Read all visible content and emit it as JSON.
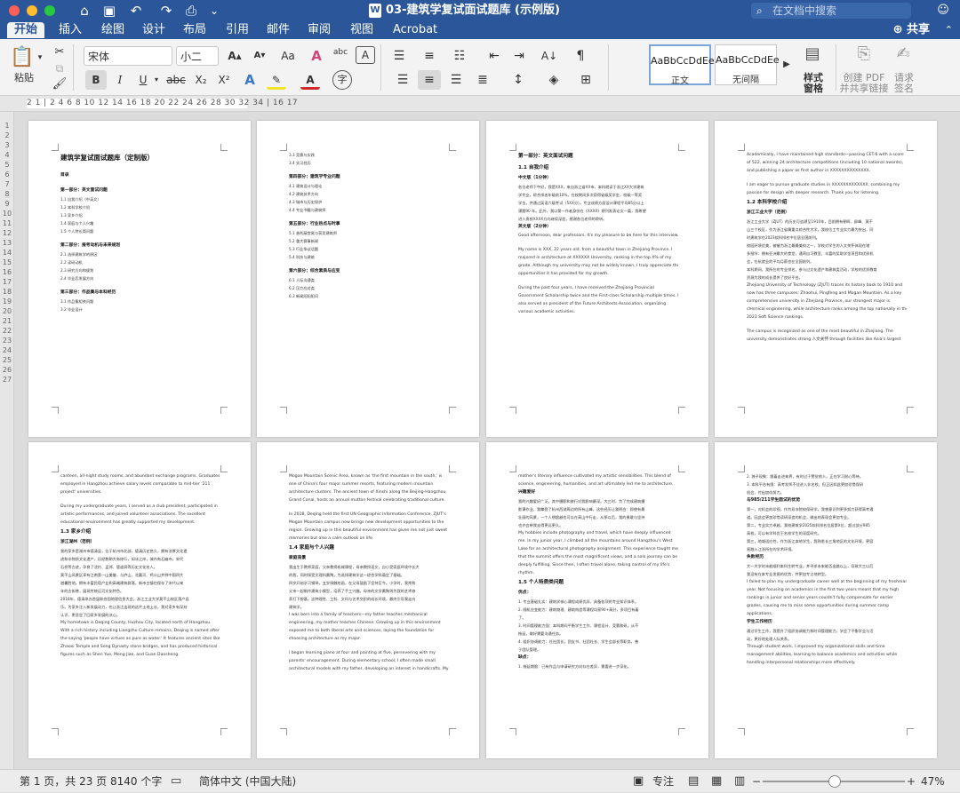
{
  "window": {
    "title": "03-建筑学复试面试题库 (示例版)",
    "doc_icon": "W",
    "search_placeholder": "在文档中搜索",
    "traffic_colors": {
      "close": "#fe5f57",
      "minimize": "#febc2e",
      "maximize": "#28c840"
    }
  },
  "quick_access": {
    "home": "⌂",
    "save": "▣",
    "undo": "↶",
    "redo": "↷",
    "print": "⎙",
    "more": "⌄"
  },
  "tabs": [
    {
      "label": "开始",
      "active": true
    },
    {
      "label": "插入"
    },
    {
      "label": "绘图"
    },
    {
      "label": "设计"
    },
    {
      "label": "布局"
    },
    {
      "label": "引用"
    },
    {
      "label": "邮件"
    },
    {
      "label": "审阅"
    },
    {
      "label": "视图"
    },
    {
      "label": "Acrobat"
    }
  ],
  "share_label": "共享",
  "ribbon": {
    "paste_label": "粘贴",
    "font_name": "宋体",
    "font_size": "小二",
    "bold": "B",
    "italic": "I",
    "underline": "U",
    "strikethrough": "abc",
    "subscript": "X₂",
    "superscript": "X²",
    "grow_font": "A▴",
    "shrink_font": "A▾",
    "change_case": "Aa",
    "clear_format": "A",
    "phonetic": "abc",
    "char_border": "A",
    "text_effects": "A",
    "highlight": "✎",
    "font_color": "A",
    "enclose": "字",
    "styles": [
      {
        "sample": "AaBbCcDdEe",
        "name": "正文",
        "active": true
      },
      {
        "sample": "AaBbCcDdEe",
        "name": "无间隔"
      }
    ],
    "styles_pane_label": "样式\n窗格",
    "create_pdf_label": "创建 PDF\n并共享链接",
    "request_sign_label": "请求\n签名"
  },
  "ruler_text": "2 1 | 2 4 6 8 10 12 14 16 18 20 22 24 26 28 30 32 34 | 16 17",
  "vruler_text": "1 2 3 4 5 6 7 8 9 10 11 12 13 14 15 16 17 18 19 20 21 22 23 24 25 26 27",
  "pages": [
    {
      "lines": [
        {
          "t": "建筑学复试面试题库（定制版）",
          "c": "title"
        },
        {
          "t": "",
          "c": "gap"
        },
        {
          "t": "目录",
          "c": "h3"
        },
        {
          "t": "",
          "c": "gap"
        },
        {
          "t": "第一部分：英文面试问题",
          "c": "h3"
        },
        {
          "t": "1.1  自我介绍（中英文）",
          "c": "cn"
        },
        {
          "t": "1.2  本科学校介绍",
          "c": "cn"
        },
        {
          "t": "1.3  家乡介绍",
          "c": "cn"
        },
        {
          "t": "1.4  家庭与个人兴趣",
          "c": "cn"
        },
        {
          "t": "1.5  个人特长简问题",
          "c": "cn"
        },
        {
          "t": "",
          "c": "gap"
        },
        {
          "t": "第二部分：报考动机与未来规划",
          "c": "h3"
        },
        {
          "t": "2.1  选择建筑学的原因",
          "c": "cn"
        },
        {
          "t": "2.2  读研动机",
          "c": "cn"
        },
        {
          "t": "2.3  研究方向和规划",
          "c": "cn"
        },
        {
          "t": "2.4  毕业后发展方向",
          "c": "cn"
        },
        {
          "t": "",
          "c": "gap"
        },
        {
          "t": "第三部分：作品集与本科经历",
          "c": "h3"
        },
        {
          "t": "3.1  作品集相关问题",
          "c": "cn"
        },
        {
          "t": "3.2  毕业设计",
          "c": "cn"
        }
      ]
    },
    {
      "lines": [
        {
          "t": "3.3  竞赛与实践",
          "c": "cn"
        },
        {
          "t": "3.4  实习经历",
          "c": "cn"
        },
        {
          "t": "",
          "c": "gap"
        },
        {
          "t": "第四部分：建筑学专业问题",
          "c": "h3"
        },
        {
          "t": "4.1  建筑设计与理论",
          "c": "cn"
        },
        {
          "t": "4.2  建筑技术方向",
          "c": "cn"
        },
        {
          "t": "4.3  城市与历史保护",
          "c": "cn"
        },
        {
          "t": "4.4  专业书籍与建筑师",
          "c": "cn"
        },
        {
          "t": "",
          "c": "gap"
        },
        {
          "t": "第五部分：行业热点与时事",
          "c": "h3"
        },
        {
          "t": "5.1  香利蔽宫尾与获奖建筑师",
          "c": "cn"
        },
        {
          "t": "5.2  重大赛事新闻",
          "c": "cn"
        },
        {
          "t": "5.3  行业争议话题",
          "c": "cn"
        },
        {
          "t": "5.4  科技与建筑",
          "c": "cn"
        },
        {
          "t": "",
          "c": "gap"
        },
        {
          "t": "第六部分：综合素质与应变",
          "c": "h3"
        },
        {
          "t": "6.1  人际沟通类",
          "c": "cn"
        },
        {
          "t": "6.2  压力应对类",
          "c": "cn"
        },
        {
          "t": "6.3  新闻阳阳阳问",
          "c": "cn"
        }
      ]
    },
    {
      "lines": [
        {
          "t": "第一部分：英文面试问题",
          "c": "h2"
        },
        {
          "t": "1.1  自我介绍",
          "c": "h2"
        },
        {
          "t": "中文版（1分钟）",
          "c": "h3"
        },
        {
          "t": "各位老师下午好，我是XXX，来自浙江省XX市。本科就读于浙江XX大学建筑",
          "c": "cn"
        },
        {
          "t": "学专业，综合排名年级前10%。在校期间多次获得省级奖学金，校级一等奖",
          "c": "cn"
        },
        {
          "t": "学金，并通过英语六级考试（5XX分）。专业成绩方面设计课程平均85分以上",
          "c": "cn"
        },
        {
          "t": "课题90 年。此外，我以第一作者身份在《XXXX》期刊发表论文一篇，我希望",
          "c": "cn"
        },
        {
          "t": "进入贵校XXXX方向继续深造，感谢各位老师的聆听。",
          "c": "cn"
        },
        {
          "t": "英文版（2分钟）",
          "c": "h3"
        },
        {
          "t": "Good afternoon, dear professors. It's my pleasure to be here for this interview.",
          "c": ""
        },
        {
          "t": "",
          "c": "gap"
        },
        {
          "t": "My name is XXX, 22 years old, from a beautiful town in Zhejiang Province. I",
          "c": ""
        },
        {
          "t": "majored in architecture at XXXXXX University, ranking in the top X% of my",
          "c": ""
        },
        {
          "t": "grade. Although my university may not be widely known, I truly appreciate the",
          "c": ""
        },
        {
          "t": "opportunities it has provided for my growth.",
          "c": ""
        },
        {
          "t": "",
          "c": "gap"
        },
        {
          "t": "During the past four years, I have received the Zhejiang Provincial",
          "c": ""
        },
        {
          "t": "Government Scholarship twice and the First-class Scholarship multiple times. I",
          "c": ""
        },
        {
          "t": "also served as president of the Future Architects Association, organizing",
          "c": ""
        },
        {
          "t": "various academic activities.",
          "c": ""
        }
      ]
    },
    {
      "lines": [
        {
          "t": "Academically, I have maintained high standards—passing CET-6 with a score",
          "c": ""
        },
        {
          "t": "of 522, winning 24 architecture competitions (including 10 national awards),",
          "c": ""
        },
        {
          "t": "and publishing a paper as first author in XXXXXXXXXXXXXX.",
          "c": ""
        },
        {
          "t": "",
          "c": "gap"
        },
        {
          "t": "I am eager to pursue graduate studies in XXXXXXXXXXXXX, combining my",
          "c": ""
        },
        {
          "t": "passion for design with deeper research. Thank you for listening.",
          "c": ""
        },
        {
          "t": "1.2  本科学校介绍",
          "c": "h2"
        },
        {
          "t": "浙江工业大学（范例）",
          "c": "h3"
        },
        {
          "t": "浙江工业大学（ZJUT）的历史可追溯至1910年，目前拥有朝晖、屏峰、莫干",
          "c": "cn"
        },
        {
          "t": "山三个校区，作为浙江省属重点综合性大学，我校位工专业实力最为突出，同",
          "c": "cn"
        },
        {
          "t": "时建筑学在2023软科排名中位居全国前列。",
          "c": "cn"
        },
        {
          "t": "校园环境优美，被誉为浙江最最美校之一，学校对学生的人文关怀体现在诸",
          "c": "cn"
        },
        {
          "t": "多细节：拥有亚洲最大的食堂，通宵自习教室，丰富的奖助学金项目和优质机",
          "c": "cn"
        },
        {
          "t": "会，在杭就业的平均月薪也在全国前列。",
          "c": "cn"
        },
        {
          "t": "本科期间，我所在的专业排名，参与过文化遗产和建筑类活动，学校的优质教育",
          "c": "cn"
        },
        {
          "t": "资源为我的成长提供了良好平台。",
          "c": "cn"
        },
        {
          "t": "Zhejiang University of Technology (ZJUT) traces its history back to 1910 and",
          "c": ""
        },
        {
          "t": "now has three campuses: Zhaohui, Pingfeng and Mogan Mountain. As a key",
          "c": ""
        },
        {
          "t": "comprehensive university in Zhejiang Province, our strongest major is",
          "c": ""
        },
        {
          "t": "chemical engineering, while architecture ranks among the top nationally in the",
          "c": ""
        },
        {
          "t": "2023 Soft Science rankings.",
          "c": ""
        },
        {
          "t": "",
          "c": "gap"
        },
        {
          "t": "The campus is recognized as one of the most beautiful in Zhejiang. The",
          "c": ""
        },
        {
          "t": "university demonstrates strong 人文关怀 through facilities like Asia's largest",
          "c": ""
        }
      ]
    },
    {
      "lines": [
        {
          "t": "canteen, all-night study rooms, and abundant exchange programs. Graduates",
          "c": ""
        },
        {
          "t": "employed in Hangzhou achieve salary levels comparable to mid-tier '211",
          "c": ""
        },
        {
          "t": "project' universities.",
          "c": ""
        },
        {
          "t": "",
          "c": "gap"
        },
        {
          "t": "During my undergraduate years, I served as a club president, participated in",
          "c": ""
        },
        {
          "t": "artistic performances, and joined volunteer associations. The excellent",
          "c": ""
        },
        {
          "t": "educational environment has greatly supported my development.",
          "c": ""
        },
        {
          "t": "1.3  家乡介绍",
          "c": "h2"
        },
        {
          "t": "浙江湖州（范例）",
          "c": "h3"
        },
        {
          "t": "我的家乡是湖州市德清县，位于杭州市北部，德清历史悠久，拥有浓厚文化遗",
          "c": "cn"
        },
        {
          "t": "迹和非物质文化遗产，历经数朝大有修行，如冰之岸，城内有石幽寺，宋代",
          "c": "cn"
        },
        {
          "t": "石桥等古迹，孕育了沈约、孟郊、管道昇等历史文化名人。",
          "c": "cn"
        },
        {
          "t": "莫干山风景区享有江南第一山美誉，与庐山、北戴河、鸡公山并称中国四大",
          "c": "cn"
        },
        {
          "t": "避暑胜地。拥有丰富民宿产业和高端建筑群落，新市古镇也保存了宋代以来",
          "c": "cn"
        },
        {
          "t": "年的古街巷，展现传统运河文化特色。",
          "c": "cn"
        },
        {
          "t": "2018年，德清承办首届联合国地理信息大会，浙江工业大学莫干山校区落户县",
          "c": "cn"
        },
        {
          "t": "乐。为家乡注入新发展动力，也让浙江出现的这片土地上长，我对家乡有深刻",
          "c": "cn"
        },
        {
          "t": "认识，更坚定了回家乡发展的决心。",
          "c": "cn"
        },
        {
          "t": "My hometown is Deqing County, Huzhou City, located north of Hangzhou.",
          "c": ""
        },
        {
          "t": "With a rich history including Liangzhu Culture remains, Deqing is named after",
          "c": ""
        },
        {
          "t": "the saying 'people have virtues as pure as water.' It features ancient sites like",
          "c": ""
        },
        {
          "t": "Zhaoxi Temple and Song Dynasty stone bridges, and has produced historical",
          "c": ""
        },
        {
          "t": "figures such as Shen Yue, Meng Jiao, and Guan Daosheng.",
          "c": ""
        }
      ]
    },
    {
      "lines": [
        {
          "t": "Mogan Mountain Scenic Area, known as 'the first mountain in the south,' is",
          "c": ""
        },
        {
          "t": "one of China's four major summer resorts, featuring modern mountain",
          "c": ""
        },
        {
          "t": "architecture clusters. The ancient town of Xinshi along the Beijing-Hangzhou",
          "c": ""
        },
        {
          "t": "Grand Canal, hosts an annual mutton festival celebrating traditional culture.",
          "c": ""
        },
        {
          "t": "",
          "c": "gap"
        },
        {
          "t": "In 2018, Deqing held the first UN Geographic Information Conference. ZJUT's",
          "c": ""
        },
        {
          "t": "Mogan Mountain campus now brings new development opportunities to the",
          "c": ""
        },
        {
          "t": "region. Growing up in this beautiful environment has given me not just sweet",
          "c": ""
        },
        {
          "t": "memories but also a calm outlook on life.",
          "c": ""
        },
        {
          "t": "1.4  家庭与个人兴趣",
          "c": "h2"
        },
        {
          "t": "家庭背景",
          "c": "h3"
        },
        {
          "t": "我出生于教师家庭，父亲教授机械课程，母亲教授语文，自小受家庭环境中长大",
          "c": "cn"
        },
        {
          "t": "的我，同时接受文理科熏陶，为选择建筑学这一综合学科奠定了基础。",
          "c": "cn"
        },
        {
          "t": "四岁开始学习钢琴，五岁接触绘画，在父母鼓励下坚持至今。小学时，我常和",
          "c": "cn"
        },
        {
          "t": "父亲一起制作建筑小模型，培养了手工兴趣。母亲的文学熏陶则为我的艺术修",
          "c": "cn"
        },
        {
          "t": "养打下根基。这种理性、工科、文科与艺术交织的成长环境，最终引导我走向",
          "c": "cn"
        },
        {
          "t": "建筑学。",
          "c": "cn"
        },
        {
          "t": "I was born into a family of teachers—my father teaches mechanical",
          "c": ""
        },
        {
          "t": "engineering, my mother teaches Chinese. Growing up in this environment",
          "c": ""
        },
        {
          "t": "exposed me to both liberal arts and sciences, laying the foundation for",
          "c": ""
        },
        {
          "t": "choosing architecture as my major.",
          "c": ""
        },
        {
          "t": "",
          "c": "gap"
        },
        {
          "t": "I began learning piano at four and painting at five, persevering with my",
          "c": ""
        },
        {
          "t": "parents' encouragement. During elementary school, I often made small",
          "c": ""
        },
        {
          "t": "architectural models with my father, developing an interest in handicrafts. My",
          "c": ""
        }
      ]
    },
    {
      "lines": [
        {
          "t": "mother's literary influence cultivated my artistic sensibilities. This blend of",
          "c": ""
        },
        {
          "t": "science, engineering, humanities, and art ultimately led me to architecture.",
          "c": ""
        },
        {
          "t": "兴趣爱好",
          "c": "h3"
        },
        {
          "t": "我的兴趣爱好广泛，其中摄影和旅行对我影响最深。大三时，为了完成建筑摄",
          "c": "cn"
        },
        {
          "t": "影课作业，我攀登了杭州西湖周边的所有山峰，这些经历让我明白：即使有最",
          "c": "cn"
        },
        {
          "t": "壮丽的风景，一个人想超越也可以在高山中行走，从那以后，我的勇敢与坚持",
          "c": "cn"
        },
        {
          "t": "也许会带我走得更远更久。",
          "c": "cn"
        },
        {
          "t": "My hobbies include photography and travel, which have deeply influenced",
          "c": ""
        },
        {
          "t": "me. In my junior year, I climbed all the mountains around Hangzhou's West",
          "c": ""
        },
        {
          "t": "Lake for an architectural photography assignment. This experience taught me",
          "c": ""
        },
        {
          "t": "that the summit offers the most magnificent views, and a solo journey can be",
          "c": ""
        },
        {
          "t": "deeply fulfilling. Since then, I often travel alone, taking control of my life's",
          "c": ""
        },
        {
          "t": "rhythm.",
          "c": ""
        },
        {
          "t": "1.5  个人特质类问题",
          "c": "h2"
        },
        {
          "t": "优点：",
          "c": "h3"
        },
        {
          "t": "1.  专业基础扎实：建筑学核心课程成绩优异，具备各项的专业知识体系。",
          "c": "cn"
        },
        {
          "t": "2.  随机应变能力：建筑物理、建筑构造等课程均获90+高分，多项目有着",
          "c": "cn"
        },
        {
          "t": "     了。",
          "c": "cn"
        },
        {
          "t": "3.  时间管理能力强：本科期间平衡学生工作、课程设计、竞赛和研，从不",
          "c": "cn"
        },
        {
          "t": "     拖延，做好需要沟通任务。",
          "c": "cn"
        },
        {
          "t": "4.  组织协调能力：任社团长，团支书、社团社长、学生会部长等职务，善",
          "c": "cn"
        },
        {
          "t": "     于团队管理。",
          "c": "cn"
        },
        {
          "t": "缺点：",
          "c": "h3"
        },
        {
          "t": "1.  拖延期限：已有作品与申请研究方向存在差异，需要进一步深化。",
          "c": "cn"
        }
      ]
    },
    {
      "lines": [
        {
          "t": "2.  独子现象：跟着走进来界，有时过于警觉他人，正在学习耐心等待。",
          "c": "cn"
        },
        {
          "t": "3.  本科平台有限：高考发挥不佳进入非名校，但正因如此更加珍惜保研",
          "c": "cn"
        },
        {
          "t": "     机会，付出加倍努力。",
          "c": "cn"
        },
        {
          "t": "与985/211学生面试的优势",
          "c": "h3"
        },
        {
          "t": "第一，对机会的珍视，作为双非院校保研学，我曾意识到更多努力获得高考通",
          "c": "cn"
        },
        {
          "t": "道。因此会更加珍惜读研深造的机会，做出的表现会更加专业。",
          "c": "cn"
        },
        {
          "t": "第二，专业实力卓越，我校建筑学2025软科排名位居第X位，超过部分985",
          "c": "cn"
        },
        {
          "t": "高校，可以有学科优于名校学生的深度研究。",
          "c": "cn"
        },
        {
          "t": "第三，地域适应性，作为浙江本地学生，我熟悉长三角地区的文化环境，更容",
          "c": "cn"
        },
        {
          "t": "易融入江浙所在的学术环境。",
          "c": "cn"
        },
        {
          "t": "失败经历",
          "c": "h3"
        },
        {
          "t": "大一大学时未能顺利本科生转专业，并寻求未来能否出路以上，导致大三以后",
          "c": "cn"
        },
        {
          "t": "我没有在本专业发掘的优势，并更加专注地转型。",
          "c": "cn"
        },
        {
          "t": "I failed to plan my undergraduate career well at the beginning of my freshman",
          "c": ""
        },
        {
          "t": "year. Not focusing on academics in the first two years meant that my high",
          "c": ""
        },
        {
          "t": "rankings in junior and senior years couldn't fully compensate for earlier",
          "c": ""
        },
        {
          "t": "grades, causing me to miss some opportunities during summer camp",
          "c": ""
        },
        {
          "t": "applications.",
          "c": ""
        },
        {
          "t": "学生工作经历",
          "c": "h3"
        },
        {
          "t": "通过学生工作，我提升了组织协调能力和时间管理能力，学会了平衡学业与活",
          "c": "cn"
        },
        {
          "t": "动，更好地处理人际关系。",
          "c": "cn"
        },
        {
          "t": "Through student work, I improved my organizational skills and time",
          "c": ""
        },
        {
          "t": "management abilities, learning to balance academics and activities while",
          "c": ""
        },
        {
          "t": "handling interpersonal relationships more effectively.",
          "c": ""
        }
      ]
    }
  ],
  "status": {
    "page": "第 1 页，共 23 页",
    "words": "8140 个字",
    "language": "简体中文 (中国大陆)",
    "focus": "专注",
    "zoom": "47%",
    "zoom_minus": "−",
    "zoom_plus": "+"
  }
}
